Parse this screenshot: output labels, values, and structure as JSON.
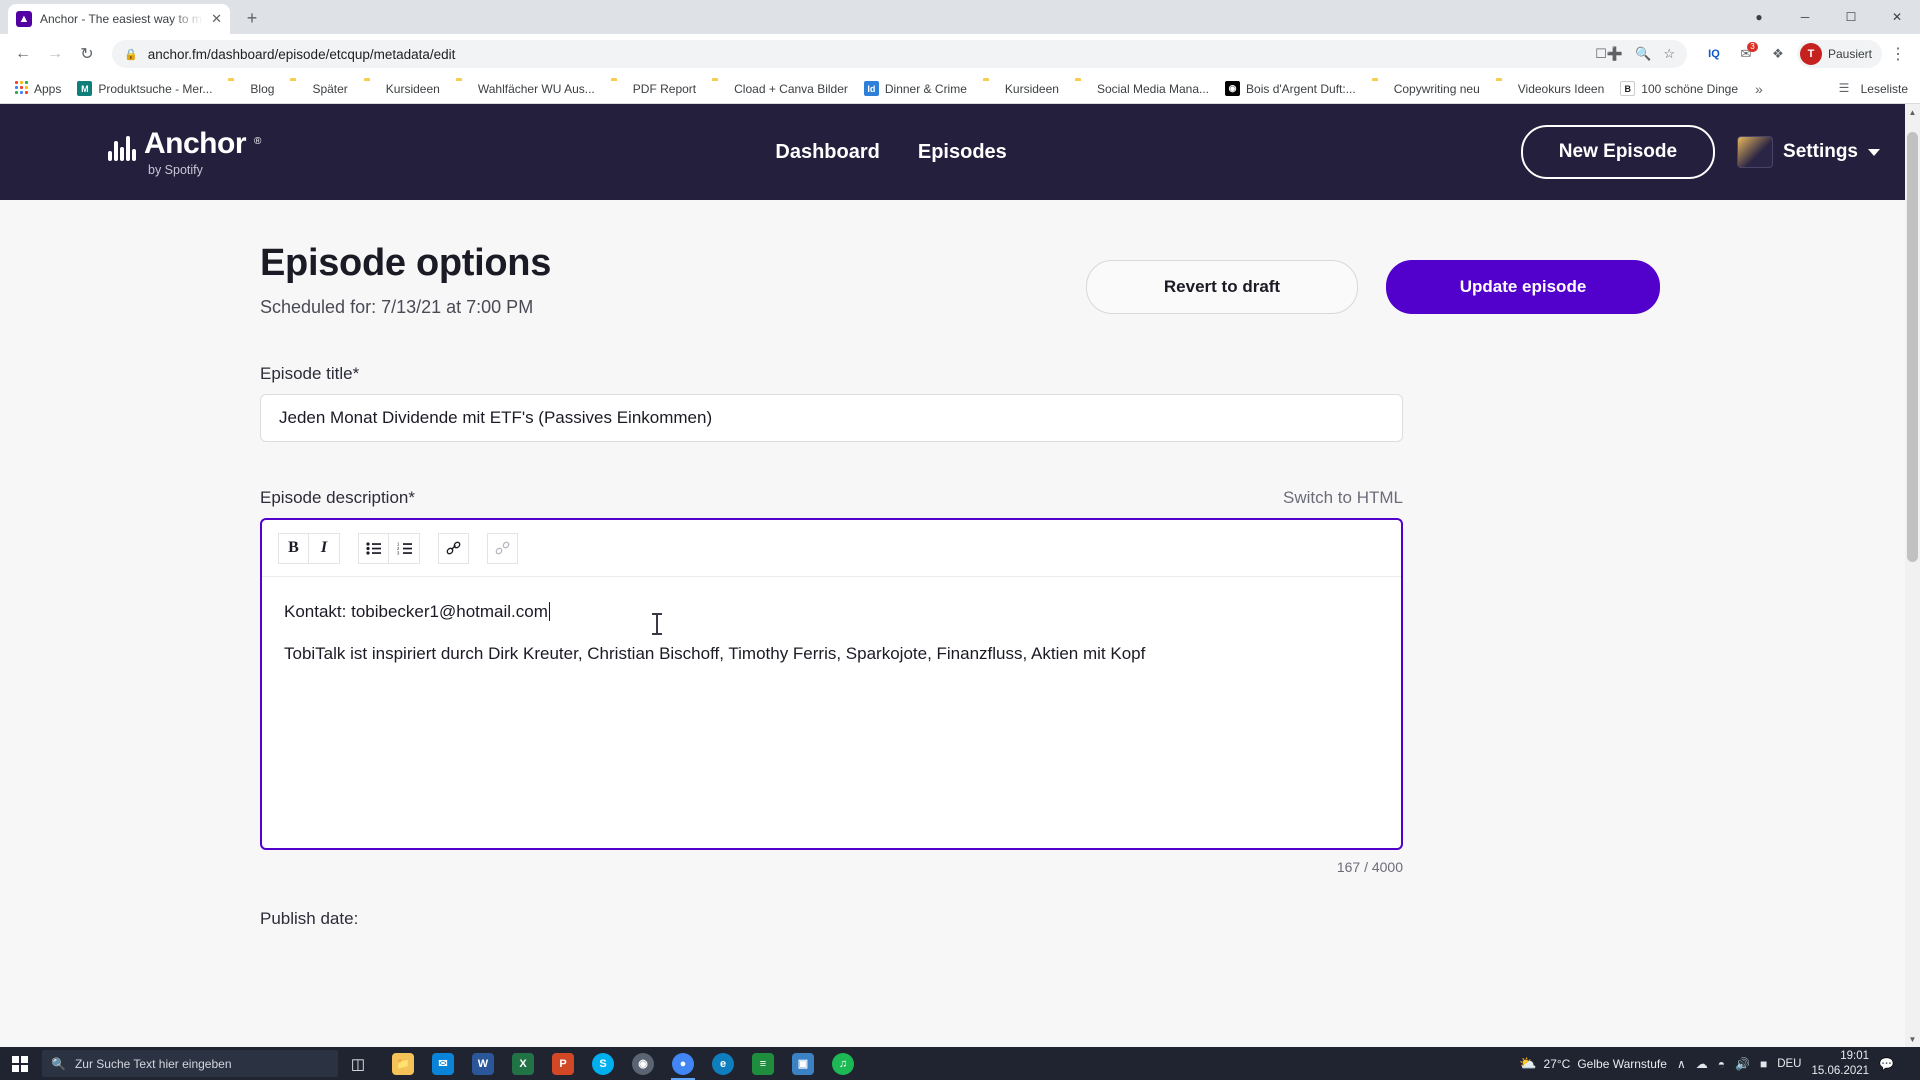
{
  "browser": {
    "tab": {
      "title": "Anchor - The easiest way to mak",
      "favicon": "anchor-icon",
      "close_label": "✕"
    },
    "new_tab_label": "+",
    "window_controls": {
      "minimize": "─",
      "maximize": "☐",
      "close": "✕"
    },
    "nav": {
      "back": "←",
      "forward": "→",
      "reload": "↻"
    },
    "omnibox": {
      "lock_icon": "lock-icon",
      "url": "anchor.fm/dashboard/episode/etcqup/metadata/edit",
      "translate_icon": "translate-icon",
      "zoom_icon": "zoom-search-icon",
      "bookmark_icon": "star-icon"
    },
    "toolbar_icons": [
      {
        "name": "extension-iq-icon",
        "glyph": "IQ"
      },
      {
        "name": "extension-notification-icon",
        "glyph": "✉",
        "badge": "3"
      },
      {
        "name": "extensions-puzzle-icon",
        "glyph": "❖"
      }
    ],
    "profile": {
      "initial": "T",
      "label": "Pausiert"
    },
    "menu_label": "⋮",
    "bookmarks": [
      {
        "label": "Apps",
        "icon": "apps-grid-icon"
      },
      {
        "label": "Produktsuche - Mer...",
        "icon": "site-icon-teal"
      },
      {
        "label": "Blog",
        "icon": "folder-icon"
      },
      {
        "label": "Später",
        "icon": "folder-icon"
      },
      {
        "label": "Kursideen",
        "icon": "folder-icon"
      },
      {
        "label": "Wahlfächer WU Aus...",
        "icon": "folder-icon"
      },
      {
        "label": "PDF Report",
        "icon": "folder-icon"
      },
      {
        "label": "Cload + Canva Bilder",
        "icon": "folder-icon"
      },
      {
        "label": "Dinner & Crime",
        "icon": "indesign-icon"
      },
      {
        "label": "Kursideen",
        "icon": "folder-icon"
      },
      {
        "label": "Social Media Mana...",
        "icon": "folder-icon"
      },
      {
        "label": "Bois d'Argent Duft:...",
        "icon": "dior-icon"
      },
      {
        "label": "Copywriting neu",
        "icon": "folder-icon"
      },
      {
        "label": "Videokurs Ideen",
        "icon": "folder-icon"
      },
      {
        "label": "100 schöne Dinge",
        "icon": "b-site-icon"
      }
    ],
    "bookmarks_overflow": "»",
    "reading_list": {
      "label": "Leseliste",
      "icon": "reading-list-icon"
    }
  },
  "app": {
    "nav": {
      "logo_text": "Anchor",
      "logo_registered": "®",
      "logo_subtitle": "by Spotify",
      "links": [
        {
          "label": "Dashboard"
        },
        {
          "label": "Episodes"
        }
      ],
      "new_episode_label": "New Episode",
      "settings_label": "Settings",
      "settings_caret": "chevron-down-icon"
    },
    "header": {
      "title": "Episode options",
      "scheduled": "Scheduled for: 7/13/21 at 7:00 PM",
      "revert_label": "Revert to draft",
      "update_label": "Update episode"
    },
    "episode_title": {
      "label": "Episode title*",
      "value": "Jeden Monat Dividende mit ETF's (Passives Einkommen)"
    },
    "episode_description": {
      "label": "Episode description*",
      "switch_html_label": "Switch to HTML",
      "toolbar": [
        {
          "name": "bold-button",
          "glyph": "B"
        },
        {
          "name": "italic-button",
          "glyph": "I"
        },
        {
          "name": "bullet-list-button",
          "glyph": "☰"
        },
        {
          "name": "numbered-list-button",
          "glyph": "☰"
        },
        {
          "name": "insert-link-button",
          "glyph": "⚭"
        },
        {
          "name": "remove-link-button",
          "glyph": "⚭"
        }
      ],
      "paragraphs": [
        "Kontakt: tobibecker1@hotmail.com",
        "TobiTalk ist inspiriert durch Dirk Kreuter, Christian Bischoff, Timothy Ferris, Sparkojote, Finanzfluss, Aktien mit Kopf"
      ],
      "counter": "167 / 4000"
    },
    "publish_date_label": "Publish date:",
    "colors": {
      "brand_purple": "#5200cc",
      "nav_dark": "#231f3d",
      "page_bg": "#f7f7f8"
    }
  },
  "taskbar": {
    "start_label": "start-button",
    "search_placeholder": "Zur Suche Text hier eingeben",
    "search_icon": "search-icon",
    "task_view_icon": "task-view-icon",
    "apps": [
      {
        "name": "file-explorer",
        "glyph": "🗀",
        "color": "#f6c358",
        "active": false
      },
      {
        "name": "mail",
        "glyph": "✉",
        "color": "#0a84d8",
        "active": false
      },
      {
        "name": "word",
        "glyph": "W",
        "color": "#2b579a",
        "active": false
      },
      {
        "name": "excel",
        "glyph": "X",
        "color": "#217346",
        "active": false
      },
      {
        "name": "powerpoint",
        "glyph": "P",
        "color": "#d24726",
        "active": false
      },
      {
        "name": "skype",
        "glyph": "S",
        "color": "#00aff0",
        "active": false
      },
      {
        "name": "disc",
        "glyph": "◎",
        "color": "#5b6472",
        "active": false
      },
      {
        "name": "chrome",
        "glyph": "●",
        "color": "#4285f4",
        "active": true
      },
      {
        "name": "edge",
        "glyph": "e",
        "color": "#0f7ebf",
        "active": false
      },
      {
        "name": "sheets",
        "glyph": "≣",
        "color": "#1e8e3e",
        "active": false
      },
      {
        "name": "photos",
        "glyph": "◰",
        "color": "#3b82c4",
        "active": false
      },
      {
        "name": "spotify",
        "glyph": "♫",
        "color": "#1db954",
        "active": false
      }
    ],
    "weather": {
      "icon": "partly-cloudy-icon",
      "temp": "27°C",
      "text": "Gelbe Warnstufe"
    },
    "tray_icons": [
      {
        "name": "show-hidden-icons",
        "glyph": "∧"
      },
      {
        "name": "onedrive-icon",
        "glyph": "☁"
      },
      {
        "name": "network-icon",
        "glyph": "📶"
      },
      {
        "name": "volume-icon",
        "glyph": "🔊"
      },
      {
        "name": "battery-icon",
        "glyph": "🔋"
      }
    ],
    "language": "DEU",
    "clock_time": "19:01",
    "clock_date": "15.06.2021",
    "notification_icon": "notification-icon"
  }
}
